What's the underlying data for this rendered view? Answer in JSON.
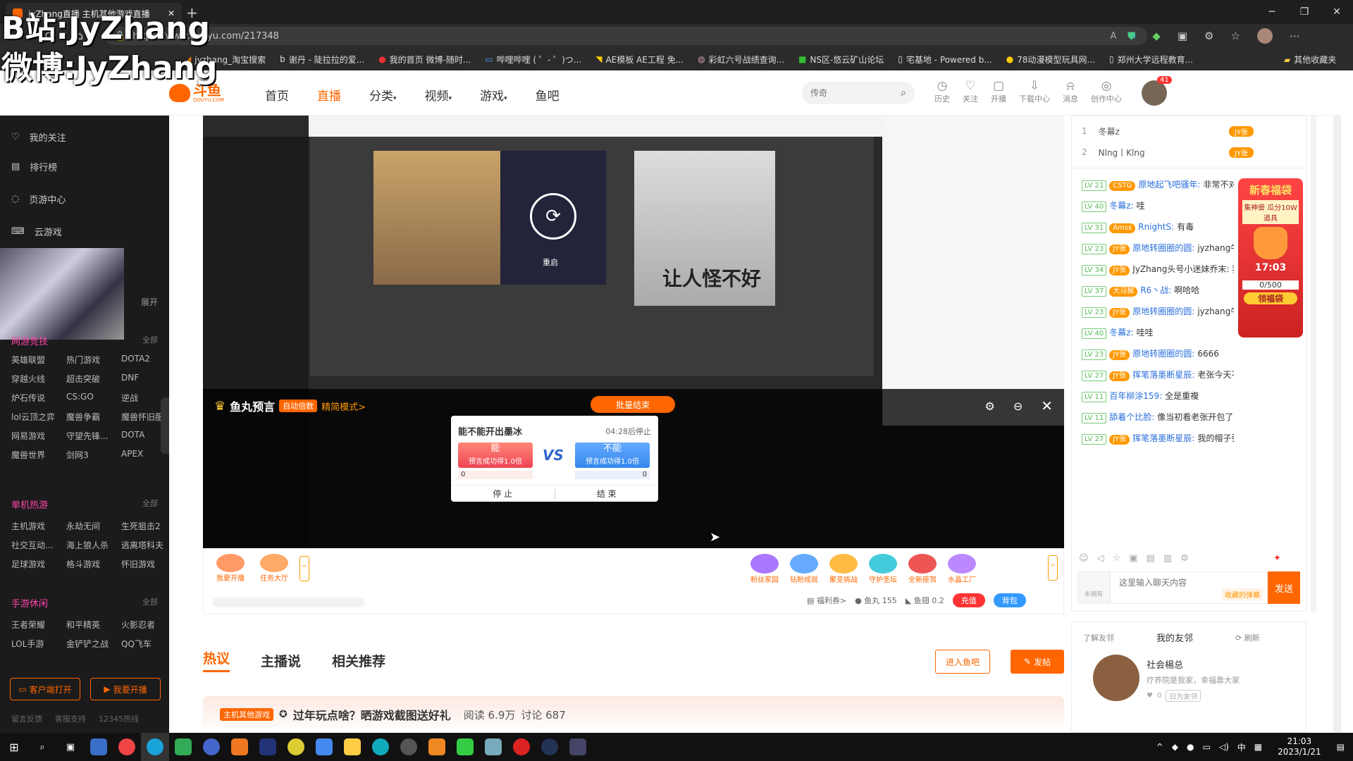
{
  "browser": {
    "tab_title": "jyZhang直播 主机其他游戏直播",
    "url": "https://www.douyu.com/217348",
    "bookmarks": [
      "jyzhang_淘宝搜索",
      "谢丹 - 陡拉拉的爱...",
      "我的首页 微博-随时...",
      "哔哩哔哩 ( ゜- ゜)つ...",
      "AE模板 AE工程 免...",
      "彩虹六号战绩查询...",
      "NS区-悠云矿山论坛",
      "宅基地 - Powered b...",
      "78动漫模型玩具网...",
      "郑州大学远程教育..."
    ],
    "other_bookmarks": "其他收藏夹"
  },
  "watermark": {
    "line1": "B站:JyZhang",
    "line2": "微博:JyZhang"
  },
  "site": {
    "logo": "斗鱼",
    "logo_sub": "DOUYU.COM",
    "nav": [
      "首页",
      "直播",
      "分类",
      "视频",
      "游戏",
      "鱼吧"
    ],
    "search_placeholder": "传奇",
    "header_tools": [
      "历史",
      "关注",
      "开播",
      "下载中心",
      "消息",
      "创作中心"
    ],
    "avatar_badge": "41"
  },
  "leftnav": {
    "items": [
      "我的关注",
      "排行榜",
      "页游中心",
      "云游戏"
    ],
    "expand": "展开",
    "online_title": "网游竞技",
    "all": "全部",
    "online_games": [
      "英雄联盟",
      "热门游戏",
      "DOTA2",
      "穿越火线",
      "超击突破",
      "DNF",
      "炉石传说",
      "CS:GO",
      "逆战",
      "lol云顶之弈",
      "魔兽争霸",
      "魔兽怀旧服",
      "网易游戏",
      "守望先锋...",
      "DOTA",
      "魔兽世界",
      "剑网3",
      "APEX"
    ],
    "single_title": "单机热游",
    "single_games": [
      "主机游戏",
      "永劫无间",
      "生死狙击2",
      "社交互动...",
      "海上狼人杀",
      "逃离塔科夫",
      "足球游戏",
      "格斗游戏",
      "怀旧游戏"
    ],
    "mobile_title": "手游休闲",
    "mobile_games": [
      "王者荣耀",
      "和平精英",
      "火影忍者",
      "LOL手游",
      "金铲铲之战",
      "QQ飞车"
    ],
    "btn_client": "客户端打开",
    "btn_live": "我要开播",
    "footer": [
      "留言反馈",
      "客服支持",
      "12345热线"
    ]
  },
  "player": {
    "predict_title": "鱼丸预言",
    "auto_badge": "自动倍数",
    "mode": "精简模式>",
    "batch_end": "批量结束",
    "question": "能不能开出墨冰",
    "timer": "04:28后停止",
    "yes": "能",
    "no": "不能",
    "odds": "预言成功得1.0倍",
    "yes_count": "0",
    "no_count": "0",
    "stop": "停 止",
    "end": "结 束",
    "vs": "VS",
    "inner_text": "让人怪不好",
    "inner_caption": "重启"
  },
  "bottombar": {
    "left_buttons": [
      "我要开播",
      "任务大厅"
    ],
    "right_buttons": [
      "粉丝家园",
      "钻粉成就",
      "聚变挑战",
      "守护圣坛",
      "全新座驾",
      "水晶工厂"
    ],
    "welfare": "福利券>",
    "yuwan": "鱼丸 155",
    "yuchi": "鱼翅 0.2",
    "recharge": "充值",
    "bag": "背包"
  },
  "tabs": [
    "热议",
    "主播说",
    "相关推荐"
  ],
  "actions": {
    "enter": "进入鱼吧",
    "post": "发帖"
  },
  "post": {
    "tag": "主机其他游戏",
    "title": "过年玩点啥？晒游戏截图送好礼",
    "reads": "阅读 6.9万",
    "comments": "讨论 687"
  },
  "rank": [
    {
      "n": "1",
      "name": "冬幕z",
      "badge": "JY张"
    },
    {
      "n": "2",
      "name": "Nlng丨Klng",
      "badge": "JY张"
    }
  ],
  "chat": [
    {
      "lv": "LV 21",
      "badge": "CSTG",
      "name": "原地起飞吧骚年:",
      "msg": "非常不对劲"
    },
    {
      "lv": "LV 40",
      "badge": "",
      "name": "冬幕z:",
      "msg": "哇"
    },
    {
      "lv": "LV 31",
      "badge": "Amss",
      "name": "RnightS:",
      "msg": "有毒"
    },
    {
      "lv": "LV 23",
      "badge": "JY张",
      "name": "原地转圈圈的圆:",
      "msg": "jyzhang牛逼！！！！！"
    },
    {
      "lv": "LV 34",
      "badge": "JY张",
      "name": "",
      "msg": "JyZhang头号小迷妹乔末: 我说惊哥哥这号墨冰多"
    },
    {
      "lv": "LV 37",
      "badge": "大马猴",
      "name": "R6丶战:",
      "msg": "啊哈哈"
    },
    {
      "lv": "LV 23",
      "badge": "JY张",
      "name": "原地转圈圈的圆:",
      "msg": "jyzhang牛逼？？？"
    },
    {
      "lv": "LV 40",
      "badge": "",
      "name": "冬幕z:",
      "msg": "哇哇"
    },
    {
      "lv": "LV 23",
      "badge": "JY张",
      "name": "原地转圈圈的圆:",
      "msg": "6666"
    },
    {
      "lv": "LV 27",
      "badge": "JY张",
      "name": "挥笔落墨断星辰:",
      "msg": "老张今天不对劲"
    },
    {
      "lv": "LV 11",
      "badge": "",
      "name": "百年柳涂159:",
      "msg": "全是重複"
    },
    {
      "lv": "LV 11",
      "badge": "",
      "name": "舔着个比脸:",
      "msg": "像当初看老张开包了"
    },
    {
      "lv": "LV 27",
      "badge": "JY张",
      "name": "挥笔落墨断星辰:",
      "msg": "我的帽子张呢 快回来"
    }
  ],
  "chat_input": {
    "placeholder": "这里输入聊天内容",
    "collect": "收藏的弹幕",
    "send": "发送",
    "unlogged": "未拥有"
  },
  "promo": {
    "title": "新春福袋",
    "sub": "集神兽 瓜分10W道具",
    "time": "17:03",
    "count": "0/500",
    "btn": "领福袋"
  },
  "friends": {
    "tab1": "了解友邻",
    "tab2": "我的友邻",
    "refresh": "刷新",
    "name": "社会楊总",
    "desc": "疗养院是我家，幸福靠大家",
    "count": "0",
    "tag": "日为友邻"
  },
  "taskbar": {
    "time": "21:03",
    "date": "2023/1/21",
    "ime": "中"
  }
}
